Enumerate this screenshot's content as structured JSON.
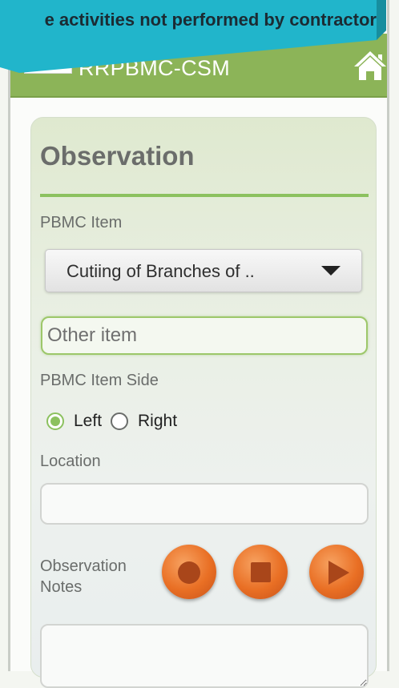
{
  "toast": {
    "message": "e activities not performed by contractor"
  },
  "app": {
    "title": "RRPBMC-CSM"
  },
  "form": {
    "heading": "Observation",
    "pbmc_item": {
      "label": "PBMC Item",
      "selected": "Cutiing of Branches of .."
    },
    "other_item": {
      "placeholder": "Other item",
      "value": ""
    },
    "item_side": {
      "label": "PBMC Item Side",
      "options": [
        {
          "label": "Left",
          "checked": true
        },
        {
          "label": "Right",
          "checked": false
        }
      ]
    },
    "location": {
      "label": "Location",
      "value": ""
    },
    "notes": {
      "label_line1": "Observation",
      "label_line2": "Notes"
    },
    "recorder_buttons": [
      "record-icon",
      "stop-icon",
      "play-icon"
    ]
  },
  "colors": {
    "appbar": "#8cb458",
    "accent_green": "#8cc15f",
    "toast_bg": "#21b5cb",
    "recorder_orange": "#e96f24"
  }
}
